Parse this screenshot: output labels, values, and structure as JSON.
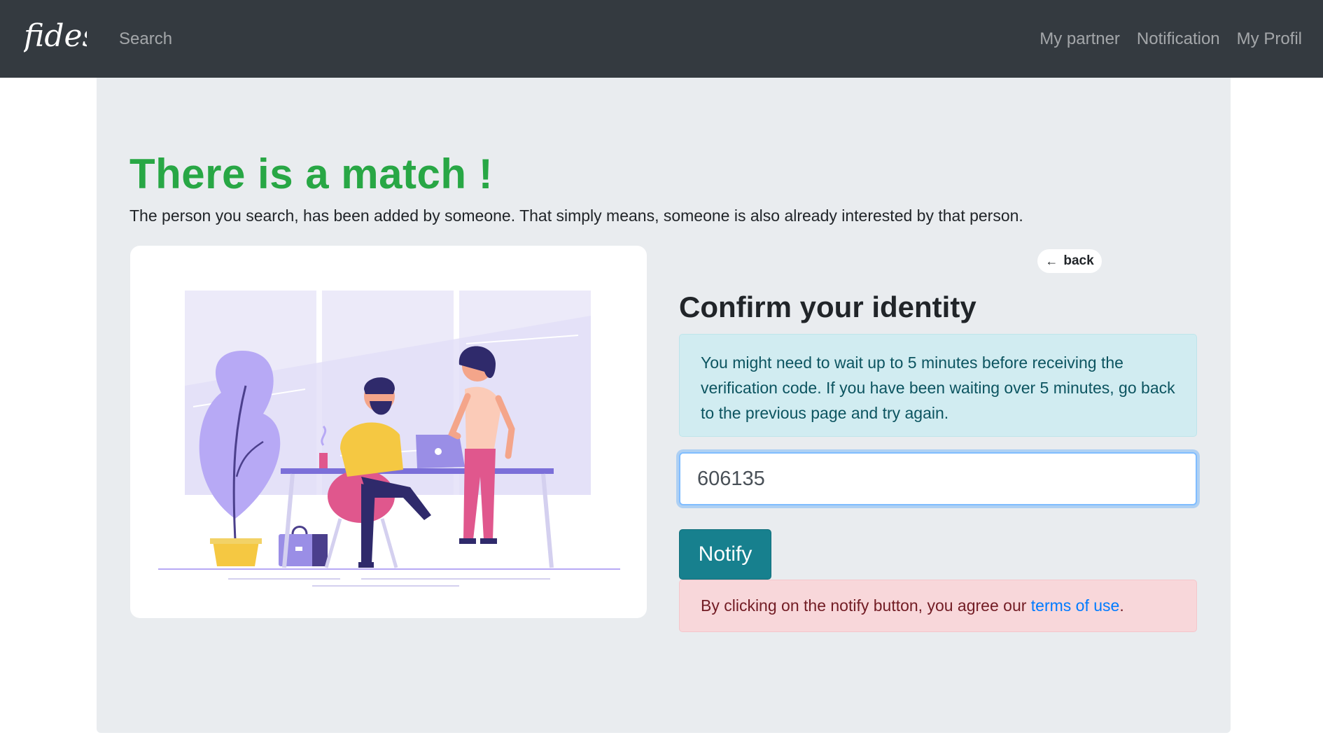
{
  "navbar": {
    "brand": "fides",
    "search_label": "Search",
    "links": [
      "My partner",
      "Notification",
      "My Profil"
    ]
  },
  "main": {
    "title": "There is a match !",
    "lead": "The person you search, has been added by someone. That simply means, someone is also already interested by that person."
  },
  "confirm": {
    "back_label": "back",
    "title": "Confirm your identity",
    "info_text": "You might need to wait up to 5 minutes before receiving the verification code. If you have been waiting over 5 minutes, go back to the previous page and try again.",
    "code_value": "606135",
    "notify_label": "Notify",
    "terms_prefix": "By clicking on the notify button, you agree our ",
    "terms_link": "terms of use",
    "terms_suffix": "."
  },
  "colors": {
    "navbar_bg": "#343a40",
    "title_green": "#28a745",
    "notify_teal": "#17808e",
    "info_bg": "#d1ecf1",
    "danger_bg": "#f8d7da",
    "illustration_accent": "#b7a9f5"
  }
}
